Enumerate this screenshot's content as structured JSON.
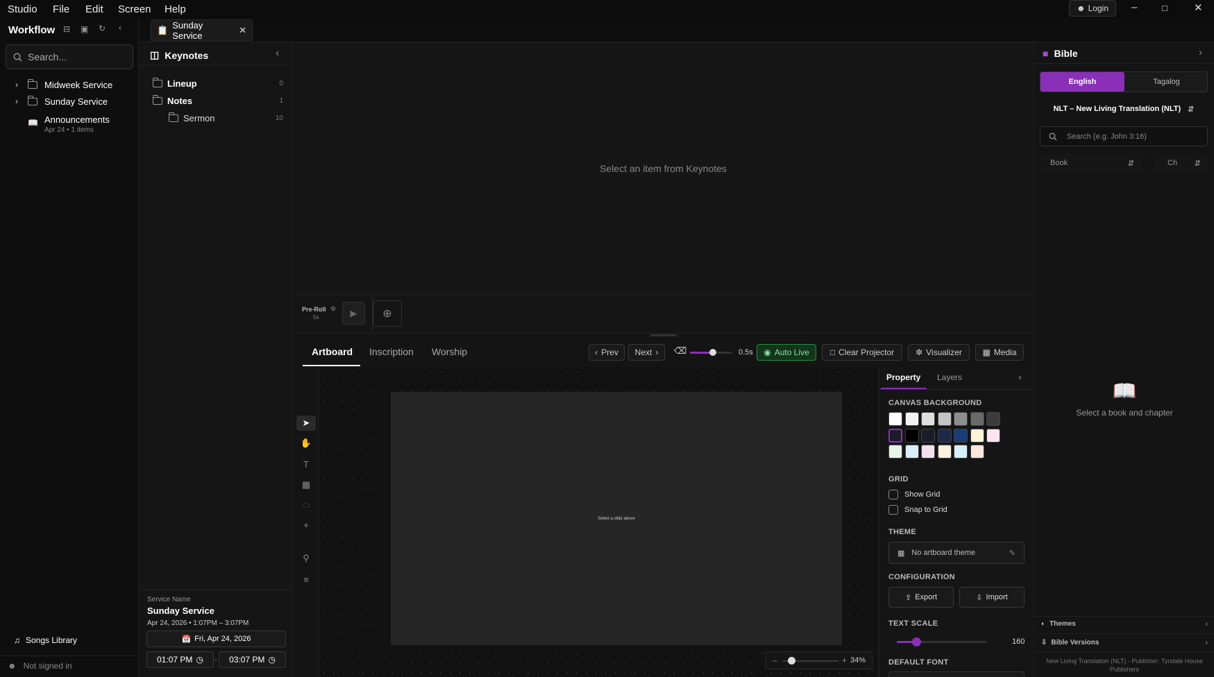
{
  "menu": {
    "items": [
      "Studio",
      "File",
      "Edit",
      "Screen",
      "Help"
    ],
    "login_label": "Login"
  },
  "sidebar": {
    "title": "Workflow",
    "search_placeholder": "Search...",
    "items": [
      {
        "label": "Midweek Service",
        "sub": ""
      },
      {
        "label": "Sunday Service",
        "sub": ""
      },
      {
        "label": "Announcements",
        "sub": "Apr 24 • 1 items"
      }
    ],
    "songs_library": "Songs Library",
    "signin_status": "Not signed in"
  },
  "tabbar": {
    "tab_title": "Sunday Service"
  },
  "keynotes": {
    "title": "Keynotes",
    "rows": [
      {
        "label": "Lineup",
        "count": "0"
      },
      {
        "label": "Notes",
        "count": "1"
      },
      {
        "label": "Sermon",
        "count": "10"
      }
    ],
    "service_name_label": "Service Name",
    "service_name": "Sunday Service",
    "service_meta": "Apr 24, 2026 • 1:07PM – 3:07PM",
    "date_button": "Fri, Apr 24, 2026",
    "start_time": "01:07 PM",
    "end_time": "03:07 PM"
  },
  "preview": {
    "empty_text": "Select an item from Keynotes",
    "preroll_label": "Pre-Roll",
    "preroll_value": "5s"
  },
  "editor": {
    "tabs": [
      "Artboard",
      "Inscription",
      "Worship"
    ],
    "prev": "Prev",
    "next": "Next",
    "transition_value": "0.5s",
    "transition_level": 0.55,
    "auto_live": "Auto Live",
    "clear_projector": "Clear Projector",
    "visualizer": "Visualizer",
    "media": "Media",
    "canvas_text": "Select a slide above",
    "zoom": "34%",
    "zoom_level": 0.15
  },
  "property": {
    "tabs": [
      "Property",
      "Layers"
    ],
    "canvas_bg_title": "CANVAS BACKGROUND",
    "swatches": [
      [
        "#ffffff",
        "#f2f2f2",
        "#e0e0e0",
        "#c4c4c4",
        "#8e8e8e",
        "#6a6a6a",
        "#3c3c3c"
      ],
      [
        "#1f1a2b",
        "#000000",
        "#1a1d29",
        "#1e2a4a",
        "#1a3d7a",
        "#fff3d6",
        "#fde4ee"
      ],
      [
        "#e6f4e8",
        "#dbeefb",
        "#f6e0ee",
        "#fdf1df",
        "#d8f0fb",
        "#fde6dd"
      ]
    ],
    "selected_swatch": "#1f1a2b",
    "grid_title": "GRID",
    "show_grid": "Show Grid",
    "snap_to_grid": "Snap to Grid",
    "theme_title": "THEME",
    "theme_value": "No artboard theme",
    "config_title": "CONFIGURATION",
    "export": "Export",
    "import": "Import",
    "text_scale_title": "TEXT SCALE",
    "text_scale_value": "160",
    "text_scale_level": 0.22,
    "default_font_title": "DEFAULT FONT"
  },
  "bible": {
    "title": "Bible",
    "lang_tabs": [
      "English",
      "Tagalog"
    ],
    "version": "NLT – New Living Translation (NLT)",
    "search_placeholder": "Search (e.g. John 3:16)",
    "book_label": "Book",
    "chapter_label": "Ch",
    "empty_text": "Select a book and chapter",
    "themes": "Themes",
    "bible_versions": "Bible Versions",
    "footer": "New Living Translation (NLT) - Publisher: Tyndale House Publishers"
  },
  "colors": {
    "accent": "#8a2fb8",
    "live_green": "#2e8b3e"
  }
}
